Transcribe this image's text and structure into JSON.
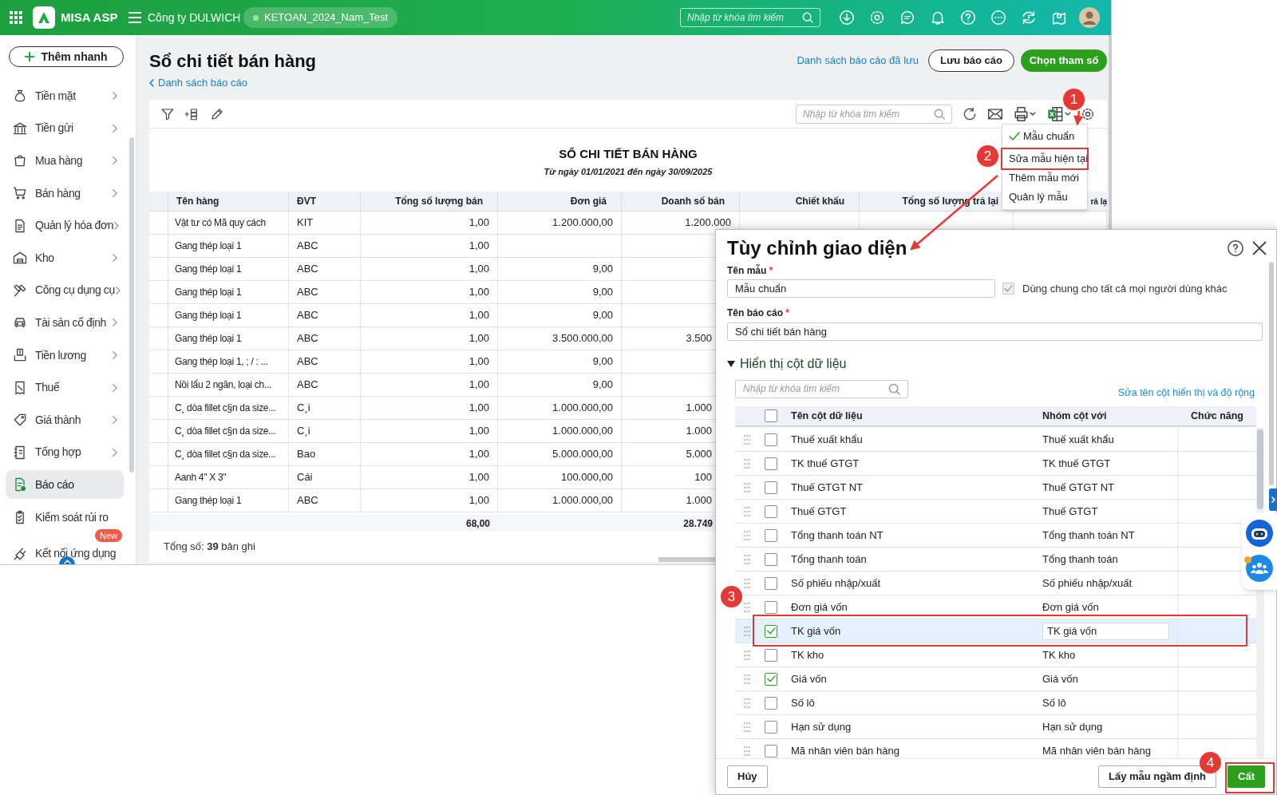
{
  "app_header": {
    "logo": "MISA ASP",
    "company": "Công ty DULWICH",
    "database": "KETOAN_2024_Nam_Test",
    "search": {
      "placeholder": "Nhập từ khóa tìm kiếm"
    }
  },
  "sidebar": {
    "quick_add": "Thêm nhanh",
    "items": [
      {
        "label": "Tiền mặt",
        "expandable": true,
        "selected": false
      },
      {
        "label": "Tiền gửi",
        "expandable": true,
        "selected": false
      },
      {
        "label": "Mua hàng",
        "expandable": true,
        "selected": false
      },
      {
        "label": "Bán hàng",
        "expandable": true,
        "selected": false
      },
      {
        "label": "Quản lý hóa đơn",
        "expandable": true,
        "selected": false
      },
      {
        "label": "Kho",
        "expandable": true,
        "selected": false
      },
      {
        "label": "Công cụ dụng cụ",
        "expandable": true,
        "selected": false
      },
      {
        "label": "Tài sản cố định",
        "expandable": true,
        "selected": false
      },
      {
        "label": "Tiền lương",
        "expandable": true,
        "selected": false
      },
      {
        "label": "Thuế",
        "expandable": true,
        "selected": false
      },
      {
        "label": "Giá thành",
        "expandable": true,
        "selected": false
      },
      {
        "label": "Tổng hợp",
        "expandable": true,
        "selected": false
      },
      {
        "label": "Báo cáo",
        "expandable": false,
        "selected": true
      },
      {
        "label": "Kiểm soát rủi ro",
        "expandable": false,
        "selected": false
      },
      {
        "label": "Kết nối ứng dụng",
        "expandable": false,
        "selected": false,
        "badge": "New"
      }
    ]
  },
  "page": {
    "title": "Sổ chi tiết bán hàng",
    "back_link": "Danh sách báo cáo",
    "saved_link": "Danh sách báo cáo đã lưu",
    "buttons": [
      {
        "label": "Lưu báo cáo",
        "kind": "outline"
      },
      {
        "label": "Chọn tham số",
        "kind": "primary"
      }
    ]
  },
  "report": {
    "search": {
      "placeholder": "Nhập từ khóa tìm kiếm"
    },
    "title": "SỔ CHI TIẾT BÁN HÀNG",
    "subtitle": "Từ ngày 01/01/2021 đến ngày 30/09/2025",
    "columns": [
      "Tên hàng",
      "ĐVT",
      "Tổng số lượng bán",
      "Đơn giá",
      "Doanh số bán",
      "Chiết khấu",
      "Tổng số lượng trả lại",
      "rả lạ"
    ],
    "rows": [
      {
        "name": "Vật tư có Mã quy cách",
        "unit": "KIT",
        "qty": "1,00",
        "price": "1.200.000,00",
        "amount": "1.200.000"
      },
      {
        "name": "Gang thép loại 1",
        "unit": "ABC",
        "qty": "1,00"
      },
      {
        "name": "Gang thép loại 1",
        "unit": "ABC",
        "qty": "1,00",
        "price": "9,00"
      },
      {
        "name": "Gang thép loại 1",
        "unit": "ABC",
        "qty": "1,00",
        "price": "9,00"
      },
      {
        "name": "Gang thép loại 1",
        "unit": "ABC",
        "qty": "1,00",
        "price": "9,00"
      },
      {
        "name": "Gang thép loại 1",
        "unit": "ABC",
        "qty": "1,00",
        "price": "3.500.000,00",
        "amount": "3.500"
      },
      {
        "name": "Gang thép loại 1, ; / : ...",
        "unit": "ABC",
        "qty": "1,00",
        "price": "9,00"
      },
      {
        "name": "Nồi lẩu 2 ngăn, loại ch...",
        "unit": "ABC",
        "qty": "1,00",
        "price": "9,00"
      },
      {
        "name": "C¸ dòa fillet c§n da size...",
        "unit": "C¸i",
        "qty": "1,00",
        "price": "1.000.000,00",
        "amount": "1.000"
      },
      {
        "name": "C¸ dòa fillet c§n da size...",
        "unit": "C¸i",
        "qty": "1,00",
        "price": "1.000.000,00",
        "amount": "1.000"
      },
      {
        "name": "C¸ dòa fillet c§n da size...",
        "unit": "Bao",
        "qty": "1,00",
        "price": "5.000.000,00",
        "amount": "5.000"
      },
      {
        "name": "Aanh 4\" X 3\"",
        "unit": "Cái",
        "qty": "1,00",
        "price": "100.000,00",
        "amount": "100"
      },
      {
        "name": "Gang thép loại 1",
        "unit": "ABC",
        "qty": "1,00",
        "price": "1.000.000,00",
        "amount": "1.000"
      }
    ],
    "totals": {
      "qty": "68,00",
      "amount": "28.749"
    },
    "record_count": "Tổng số: **39** bản ghi"
  },
  "template_menu": {
    "items": [
      {
        "label": "Mẫu chuẩn",
        "checked": true
      },
      {
        "label": "Sửa mẫu hiện tại",
        "checked": false
      },
      {
        "label": "Thêm mẫu mới",
        "checked": false
      },
      {
        "label": "Quản lý mẫu",
        "checked": false
      }
    ]
  },
  "dialog": {
    "title": "Tùy chỉnh giao diện",
    "template_name": {
      "label": "Tên mẫu",
      "required_mark": "*",
      "value": "Mẫu chuẩn"
    },
    "share": {
      "label": "Dùng chung cho tất cả mọi người dùng khác",
      "checked": true,
      "disabled": true
    },
    "report_name": {
      "label": "Tên báo cáo",
      "required_mark": "*",
      "value": "Sổ chi tiết bán hàng"
    },
    "section": {
      "label": "Hiển thị cột dữ liệu",
      "expanded": true
    },
    "search": {
      "placeholder": "Nhập từ khóa tìm kiếm"
    },
    "rename_link": "Sửa tên cột hiển thị và độ rộng",
    "select_all": {
      "checked": false
    },
    "columns": [
      "Tên cột dữ liệu",
      "Nhóm cột với",
      "Chức năng"
    ],
    "rows": [
      {
        "name": "Thuế xuất khẩu",
        "group": "Thuế xuất khẩu",
        "checked": false,
        "selected": false
      },
      {
        "name": "TK thuế GTGT",
        "group": "TK thuế GTGT",
        "checked": false,
        "selected": false
      },
      {
        "name": "Thuế GTGT NT",
        "group": "Thuế GTGT NT",
        "checked": false,
        "selected": false
      },
      {
        "name": "Thuế GTGT",
        "group": "Thuế GTGT",
        "checked": false,
        "selected": false
      },
      {
        "name": "Tổng thanh toán NT",
        "group": "Tổng thanh toán NT",
        "checked": false,
        "selected": false
      },
      {
        "name": "Tổng thanh toán",
        "group": "Tổng thanh toán",
        "checked": false,
        "selected": false
      },
      {
        "name": "Số phiếu nhập/xuất",
        "group": "Số phiếu nhập/xuất",
        "checked": false,
        "selected": false
      },
      {
        "name": "Đơn giá vốn",
        "group": "Đơn giá vốn",
        "checked": false,
        "selected": false
      },
      {
        "name": "TK giá vốn",
        "group": "TK giá vốn",
        "checked": true,
        "selected": true
      },
      {
        "name": "TK kho",
        "group": "TK kho",
        "checked": false,
        "selected": false
      },
      {
        "name": "Giá vốn",
        "group": "Giá vốn",
        "checked": true,
        "selected": false
      },
      {
        "name": "Số lô",
        "group": "Số lô",
        "checked": false,
        "selected": false
      },
      {
        "name": "Hạn sử dụng",
        "group": "Hạn sử dụng",
        "checked": false,
        "selected": false
      },
      {
        "name": "Mã nhân viên bán hàng",
        "group": "Mã nhân viên bán hàng",
        "checked": false,
        "selected": false
      }
    ],
    "buttons": [
      {
        "label": "Hủy",
        "kind": "secondary"
      },
      {
        "label": "Lấy mẫu ngầm định",
        "kind": "secondary"
      },
      {
        "label": "Cất",
        "kind": "primary"
      }
    ]
  },
  "annotations": {
    "callouts": [
      "1",
      "2",
      "3",
      "4"
    ]
  }
}
